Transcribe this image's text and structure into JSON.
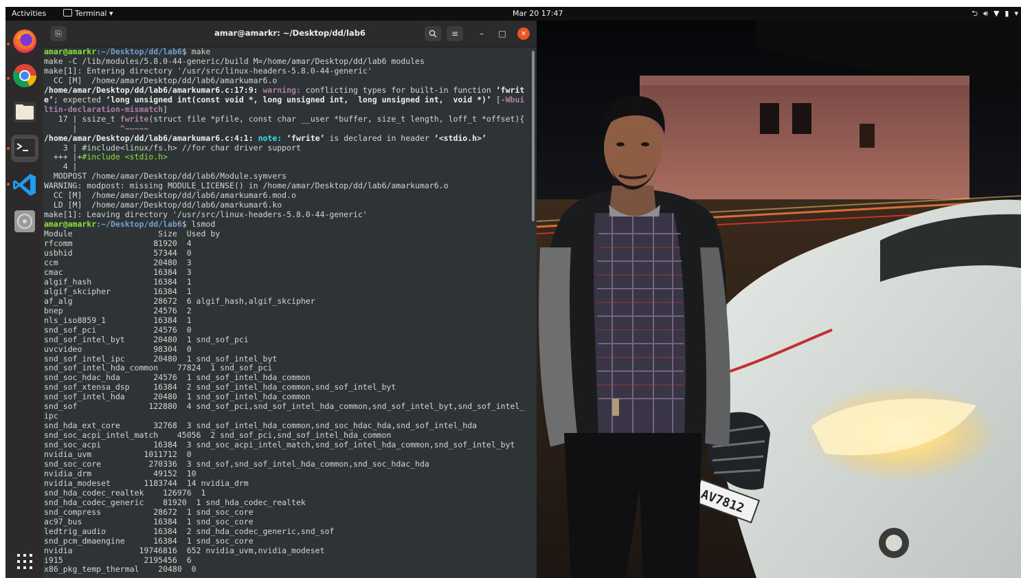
{
  "topbar": {
    "activities": "Activities",
    "app_menu": "Terminal ▾",
    "clock": "Mar 20  17:47",
    "tray_icons": [
      "network-icon",
      "volume-icon",
      "microphone-icon",
      "battery-icon",
      "menu-arrow-icon"
    ]
  },
  "dock": {
    "items": [
      "firefox-icon",
      "chrome-icon",
      "files-icon",
      "terminal-icon",
      "vscode-icon",
      "disc-icon"
    ],
    "show_apps": "show-applications-icon"
  },
  "terminal": {
    "title": "amar@amarkr: ~/Desktop/dd/lab6",
    "prompt_user": "amar@amarkr",
    "prompt_path": ":~/Desktop/dd/lab6",
    "cmd_make": "$ make",
    "cmd_lsmod": "$ lsmod",
    "make_lines": [
      "make -C /lib/modules/5.8.0-44-generic/build M=/home/amar/Desktop/dd/lab6 modules",
      "make[1]: Entering directory '/usr/src/linux-headers-5.8.0-44-generic'",
      "  CC [M]  /home/amar/Desktop/dd/lab6/amarkumar6.o"
    ],
    "warning": {
      "location": "/home/amar/Desktop/dd/lab6/amarkumar6.c:17:9:",
      "label": " warning:",
      "text1": " conflicting types for built-in function ",
      "func1": "‘fwrit",
      "line2a": "e’",
      "line2b": "; expected ",
      "expected": "‘long unsigned int(const void *, long unsigned int,  long unsigned int,  void *)’",
      "flag_open": " [",
      "flag1": "-Wbui",
      "flag2": "ltin-declaration-mismatch",
      "flag_close": "]",
      "src_a": "   17 | ssize_t ",
      "src_fn": "fwrite",
      "src_b": "(struct file *pfile, const char __user *buffer, size_t length, loff_t *offset){",
      "caret_pre": "      |         ",
      "caret": "^~~~~~"
    },
    "note": {
      "location": "/home/amar/Desktop/dd/lab6/amarkumar6.c:4:1:",
      "label": " note:",
      "text1": " ",
      "func": "‘fwrite’",
      "text2": " is declared in header ",
      "header": "‘<stdio.h>’",
      "src1": "    3 | #include<linux/fs.h> //for char driver support",
      "fix_a": "  +++ |+",
      "fix_b": "#include <stdio.h>",
      "src2": "    4 |"
    },
    "post_lines": [
      "  MODPOST /home/amar/Desktop/dd/lab6/Module.symvers",
      "WARNING: modpost: missing MODULE_LICENSE() in /home/amar/Desktop/dd/lab6/amarkumar6.o",
      "  CC [M]  /home/amar/Desktop/dd/lab6/amarkumar6.mod.o",
      "  LD [M]  /home/amar/Desktop/dd/lab6/amarkumar6.ko",
      "make[1]: Leaving directory '/usr/src/linux-headers-5.8.0-44-generic'"
    ],
    "lsmod_lines": [
      "Module                  Size  Used by",
      "rfcomm                 81920  4",
      "usbhid                 57344  0",
      "ccm                    20480  3",
      "cmac                   16384  3",
      "algif_hash             16384  1",
      "algif_skcipher         16384  1",
      "af_alg                 28672  6 algif_hash,algif_skcipher",
      "bnep                   24576  2",
      "nls_iso8859_1          16384  1",
      "snd_sof_pci            24576  0",
      "snd_sof_intel_byt      20480  1 snd_sof_pci",
      "uvcvideo               98304  0",
      "snd_sof_intel_ipc      20480  1 snd_sof_intel_byt",
      "snd_sof_intel_hda_common    77824  1 snd_sof_pci",
      "snd_soc_hdac_hda       24576  1 snd_sof_intel_hda_common",
      "snd_sof_xtensa_dsp     16384  2 snd_sof_intel_hda_common,snd_sof_intel_byt",
      "snd_sof_intel_hda      20480  1 snd_sof_intel_hda_common",
      "snd_sof               122880  4 snd_sof_pci,snd_sof_intel_hda_common,snd_sof_intel_byt,snd_sof_intel_",
      "ipc",
      "snd_hda_ext_core       32768  3 snd_sof_intel_hda_common,snd_soc_hdac_hda,snd_sof_intel_hda",
      "snd_soc_acpi_intel_match    45056  2 snd_sof_pci,snd_sof_intel_hda_common",
      "snd_soc_acpi           16384  3 snd_soc_acpi_intel_match,snd_sof_intel_hda_common,snd_sof_intel_byt",
      "nvidia_uvm           1011712  0",
      "snd_soc_core          270336  3 snd_sof,snd_sof_intel_hda_common,snd_soc_hdac_hda",
      "nvidia_drm             49152  10",
      "nvidia_modeset       1183744  14 nvidia_drm",
      "snd_hda_codec_realtek    126976  1",
      "snd_hda_codec_generic    81920  1 snd_hda_codec_realtek",
      "snd_compress           28672  1 snd_soc_core",
      "ac97_bus               16384  1 snd_soc_core",
      "ledtrig_audio          16384  2 snd_hda_codec_generic,snd_sof",
      "snd_pcm_dmaengine      16384  1 snd_soc_core",
      "nvidia              19746816  652 nvidia_uvm,nvidia_modeset",
      "i915                 2195456  6",
      "x86_pkg_temp_thermal    20480  0"
    ]
  },
  "wallpaper": {
    "plate_text": "AV7812"
  },
  "colors": {
    "topbar_bg": "#0f0f0f",
    "dock_bg": "#2c2a2b",
    "terminal_bg": "#2e3436",
    "prompt_user": "#8ae234",
    "prompt_path": "#729fcf",
    "warning": "#ad7fa8",
    "note": "#34e2e2",
    "close_button": "#e95420"
  }
}
